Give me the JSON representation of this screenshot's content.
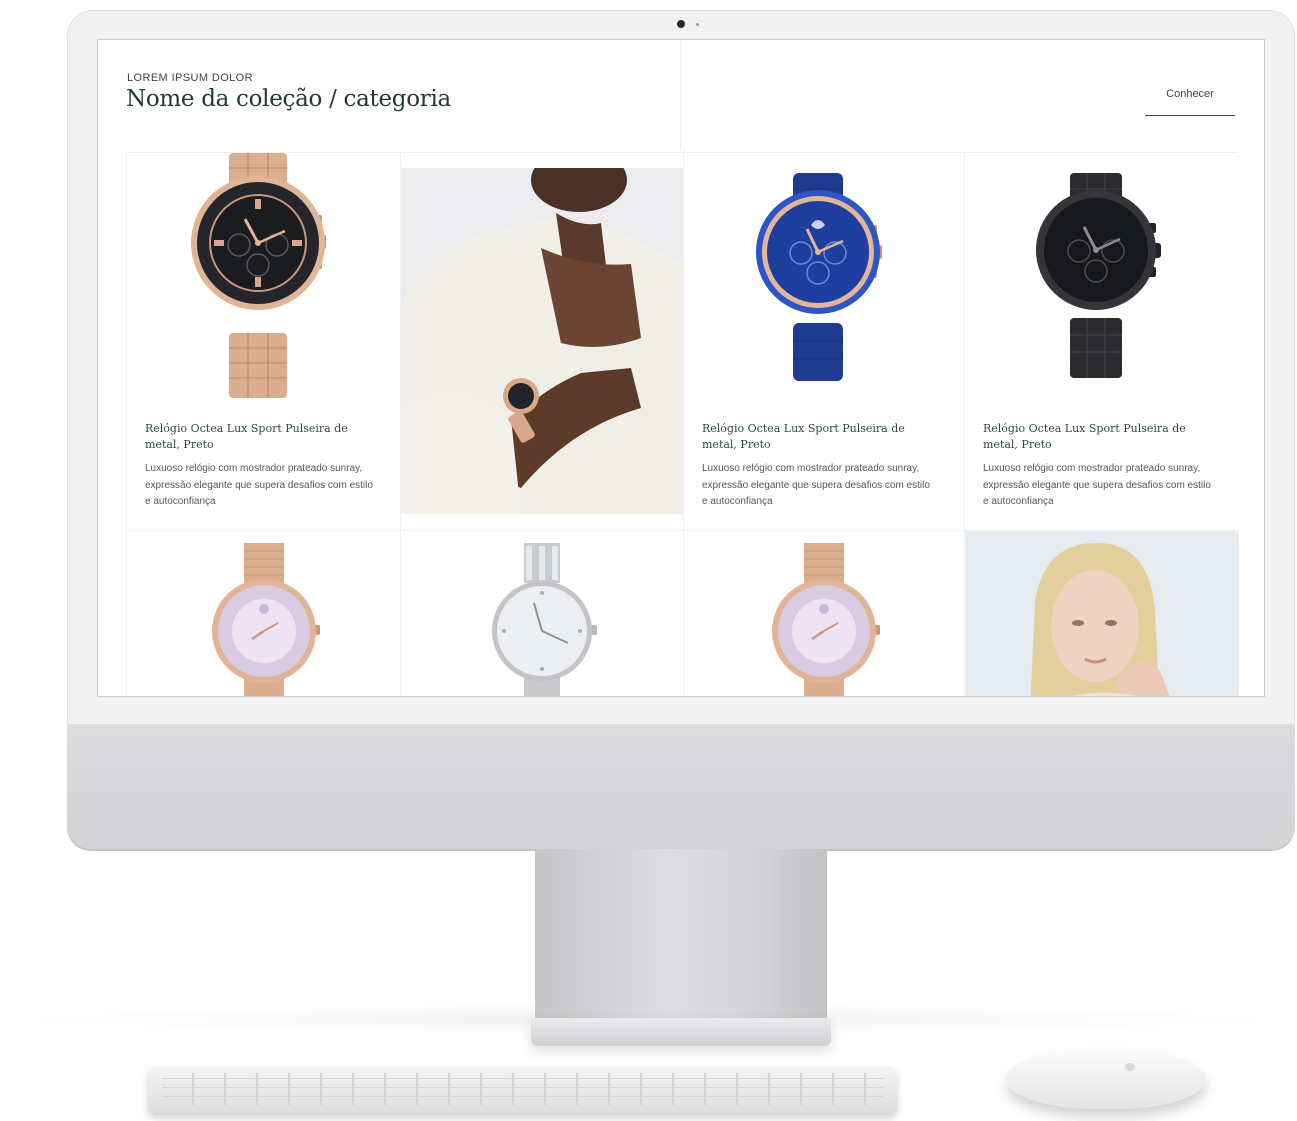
{
  "header": {
    "eyebrow": "LOREM IPSUM DOLOR",
    "title": "Nome da coleção / categoria",
    "cta_label": "Conhecer"
  },
  "products": [
    {
      "name": "Relógio Octea Lux Sport Pulseira de metal, Preto",
      "description": "Luxuoso relógio com mostrador prateado sunray, expressão elegante que supera desafios com estilo e autoconfiança",
      "image": "rose-gold-chronograph-watch"
    },
    {
      "name": "Relógio Octea Lux Sport Pulseira de metal, Preto",
      "description": "Luxuoso relógio com mostrador prateado sunray, expressão elegante que supera desafios com estilo e autoconfiança",
      "image": "blue-leather-chronograph-watch"
    },
    {
      "name": "Relógio Octea Lux Sport Pulseira de metal, Preto",
      "description": "Luxuoso relógio com mostrador prateado sunray, expressão elegante que supera desafios com estilo e autoconfiança",
      "image": "black-chronograph-watch"
    }
  ],
  "images": {
    "lifestyle_1": "man-wearing-watch-photo",
    "lifestyle_2": "woman-portrait-photo",
    "row2": [
      "rose-gold-mesh-watch",
      "silver-crystal-watch",
      "rose-gold-mesh-watch"
    ]
  },
  "colors": {
    "title": "#1f3a2f",
    "product_name": "#2d4a3c",
    "rose_gold": "#d9a88a",
    "dial_black": "#1c1d22",
    "dial_blue": "#1f3f9e"
  }
}
